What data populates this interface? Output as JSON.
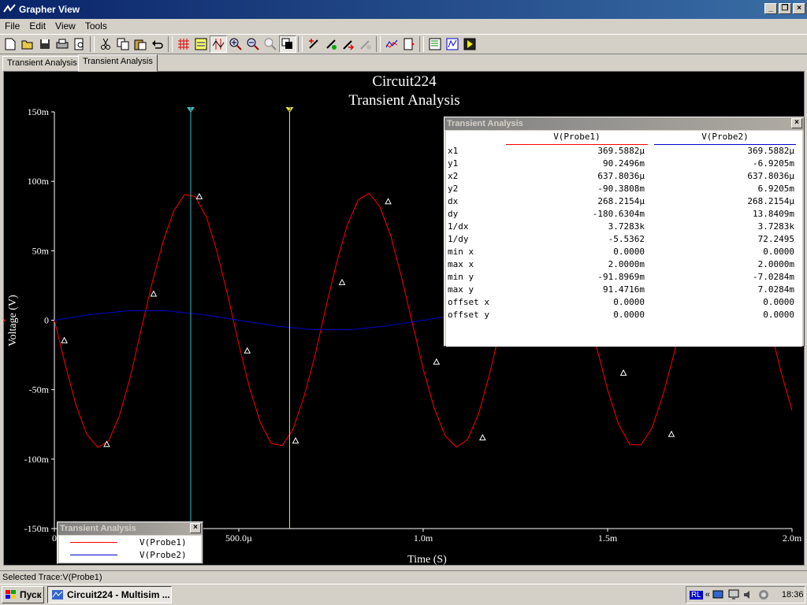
{
  "window": {
    "title": "Grapher View"
  },
  "menu": [
    "File",
    "Edit",
    "View",
    "Tools"
  ],
  "toolbar": [
    "new-icon",
    "open-icon",
    "save-icon",
    "print-icon",
    "print-preview-icon",
    "cut-icon",
    "copy-icon",
    "paste-icon",
    "undo-icon",
    "grid-icon",
    "legend-icon",
    "cursors-icon",
    "zoom-in-icon",
    "zoom-out-icon",
    "zoom-full-icon",
    "reverse-colors-icon",
    "add-trace-icon",
    "trace-properties-icon",
    "cursor-export-icon",
    "overlay-icon",
    "export-icon",
    "excel-icon",
    "mathcad-icon",
    "labview-icon"
  ],
  "tabs": [
    "Transient Analysis",
    "Transient Analysis"
  ],
  "chart_data": {
    "type": "line",
    "title": "Circuit224",
    "subtitle": "Transient Analysis",
    "xlabel": "Time (S)",
    "ylabel": "Voltage (V)",
    "xlim": [
      0,
      0.002
    ],
    "ylim": [
      -0.15,
      0.15
    ],
    "x_ticks": [
      {
        "v": 0,
        "label": "0"
      },
      {
        "v": 0.0005,
        "label": "500.0µ"
      },
      {
        "v": 0.001,
        "label": "1.0m"
      },
      {
        "v": 0.0015,
        "label": "1.5m"
      },
      {
        "v": 0.002,
        "label": "2.0m"
      }
    ],
    "y_ticks": [
      {
        "v": 0.15,
        "label": "150m"
      },
      {
        "v": 0.1,
        "label": "100m"
      },
      {
        "v": 0.05,
        "label": "50m"
      },
      {
        "v": 0,
        "label": "0"
      },
      {
        "v": -0.05,
        "label": "-50m"
      },
      {
        "v": -0.1,
        "label": "-100m"
      },
      {
        "v": -0.15,
        "label": "-150m"
      }
    ],
    "series": [
      {
        "name": "V(Probe1)",
        "color": "#ff0000",
        "x": [
          0.0,
          2.94e-05,
          5.88e-05,
          8.82e-05,
          0.000118,
          0.000147,
          0.000176,
          0.000206,
          0.000235,
          0.000265,
          0.000294,
          0.000324,
          0.000353,
          0.000382,
          0.000412,
          0.000441,
          0.000471,
          0.0005,
          0.000529,
          0.000559,
          0.000588,
          0.000618,
          0.000647,
          0.000676,
          0.000706,
          0.000735,
          0.000765,
          0.000794,
          0.000824,
          0.000853,
          0.000882,
          0.000912,
          0.000941,
          0.000971,
          0.001,
          0.00103,
          0.00106,
          0.00109,
          0.00112,
          0.00115,
          0.00118,
          0.00121,
          0.00124,
          0.00126,
          0.00129,
          0.00132,
          0.00135,
          0.00138,
          0.00141,
          0.00144,
          0.00147,
          0.0015,
          0.00153,
          0.00156,
          0.00159,
          0.00162,
          0.00165,
          0.00168,
          0.00171,
          0.00174,
          0.00176,
          0.00179,
          0.00182,
          0.00185,
          0.00188,
          0.00191,
          0.00194,
          0.00197,
          0.002
        ],
        "y": [
          0,
          -0.0319,
          -0.0613,
          -0.0824,
          -0.0916,
          -0.087,
          -0.069,
          -0.0407,
          -0.0071,
          0.0267,
          0.056,
          0.0787,
          0.0905,
          0.089,
          0.0745,
          0.0491,
          0.0169,
          -0.0172,
          -0.0486,
          -0.074,
          -0.0887,
          -0.0903,
          -0.0785,
          -0.0556,
          -0.0261,
          0.008,
          0.0411,
          0.0683,
          0.0867,
          0.0914,
          0.082,
          0.0608,
          0.0312,
          -0.0025,
          -0.035,
          -0.0633,
          -0.0834,
          -0.0914,
          -0.0859,
          -0.0676,
          -0.0387,
          -0.0049,
          0.0283,
          0.0575,
          0.0797,
          0.0908,
          0.0884,
          0.0736,
          0.0474,
          0.015,
          -0.0192,
          -0.0501,
          -0.075,
          -0.0893,
          -0.0899,
          -0.0777,
          -0.054,
          -0.0242,
          0.0099,
          0.0424,
          0.0697,
          0.0872,
          0.091,
          0.0813,
          0.0594,
          0.0293,
          -0.0045,
          -0.0372,
          -0.0649
        ]
      },
      {
        "name": "V(Probe2)",
        "color": "#0000cc",
        "x": [
          0,
          0.0001,
          0.0002,
          0.0003,
          0.0004,
          0.0005,
          0.0006,
          0.0007,
          0.0008,
          0.0009,
          0.001,
          0.0011,
          0.0012,
          0.0013,
          0.0014,
          0.0015,
          0.0016,
          0.0017,
          0.0018,
          0.0019,
          0.002
        ],
        "y": [
          0,
          0.0042,
          0.0068,
          0.0068,
          0.0042,
          0,
          -0.0042,
          -0.0068,
          -0.0068,
          -0.0042,
          0,
          0.0042,
          0.0068,
          0.0068,
          0.0042,
          0,
          -0.0042,
          -0.0068,
          -0.0068,
          -0.0042,
          0
        ]
      }
    ],
    "markers_probe1": [
      {
        "x": 2.7e-05,
        "y": -0.0148
      },
      {
        "x": 0.000142,
        "y": -0.0895
      },
      {
        "x": 0.000269,
        "y": 0.0187
      },
      {
        "x": 0.000393,
        "y": 0.0888
      },
      {
        "x": 0.000523,
        "y": -0.0222
      },
      {
        "x": 0.000654,
        "y": -0.087
      },
      {
        "x": 0.00078,
        "y": 0.027
      },
      {
        "x": 0.000905,
        "y": 0.0852
      },
      {
        "x": 0.001036,
        "y": -0.0302
      },
      {
        "x": 0.001161,
        "y": -0.0848
      },
      {
        "x": 0.001543,
        "y": -0.0382
      },
      {
        "x": 0.001673,
        "y": -0.0823
      }
    ],
    "cursors": [
      {
        "x": 0.0003695882,
        "color": "#40c0c0"
      },
      {
        "x": 0.0006378036,
        "color": "#e8e040"
      }
    ]
  },
  "cursor_window": {
    "title": "Transient Analysis",
    "headers": [
      "V(Probe1)",
      "V(Probe2)"
    ],
    "rows": [
      [
        "x1",
        "369.5882µ",
        "369.5882µ"
      ],
      [
        "y1",
        "90.2496m",
        "-6.9205m"
      ],
      [
        "x2",
        "637.8036µ",
        "637.8036µ"
      ],
      [
        "y2",
        "-90.3808m",
        "6.9205m"
      ],
      [
        "dx",
        "268.2154µ",
        "268.2154µ"
      ],
      [
        "dy",
        "-180.6304m",
        "13.8409m"
      ],
      [
        "1/dx",
        "3.7283k",
        "3.7283k"
      ],
      [
        "1/dy",
        "-5.5362",
        "72.2495"
      ],
      [
        "min x",
        "0.0000",
        "0.0000"
      ],
      [
        "max x",
        "2.0000m",
        "2.0000m"
      ],
      [
        "min y",
        "-91.8969m",
        "-7.0284m"
      ],
      [
        "max y",
        "91.4716m",
        "7.0284m"
      ],
      [
        "offset x",
        "0.0000",
        "0.0000"
      ],
      [
        "offset y",
        "0.0000",
        "0.0000"
      ]
    ]
  },
  "legend_window": {
    "title": "Transient Analysis",
    "entries": [
      {
        "label": "V(Probe1)",
        "color": "#ff0000"
      },
      {
        "label": "V(Probe2)",
        "color": "#0000cc"
      }
    ]
  },
  "status": "Selected Trace:V(Probe1)",
  "taskbar": {
    "start": "Пуск",
    "task": "Circuit224 - Multisim ...",
    "lang": "RL",
    "clock": "18:36"
  }
}
